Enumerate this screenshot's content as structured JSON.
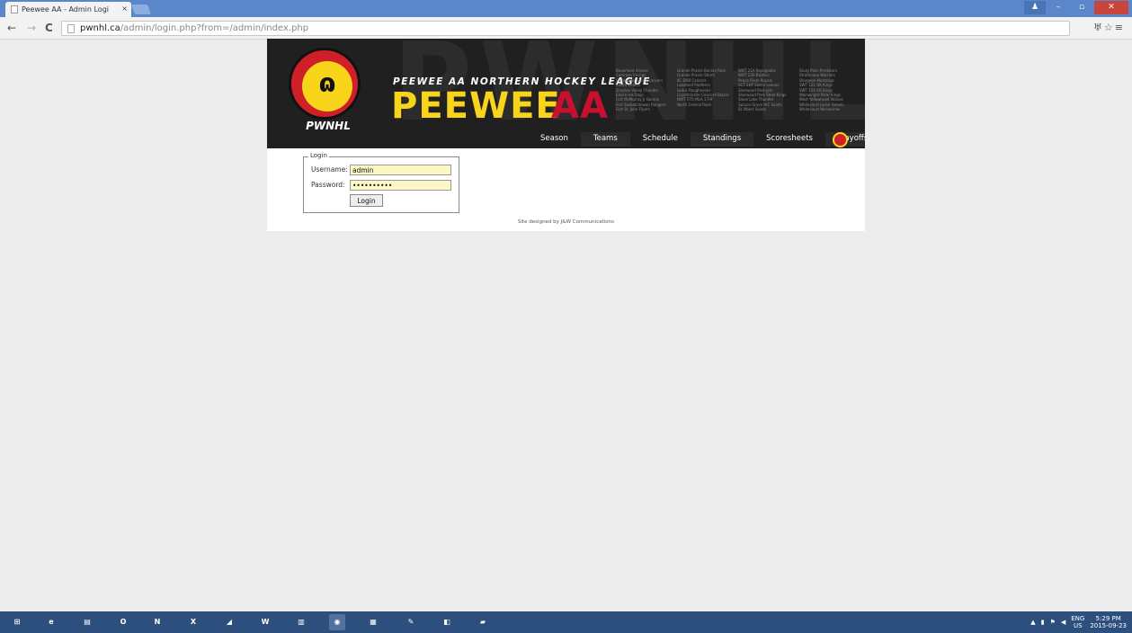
{
  "browser": {
    "tab_title": "Peewee AA - Admin Logi",
    "tab_close": "×",
    "back": "←",
    "forward": "→",
    "reload": "C",
    "url_host": "pwnhl.ca",
    "url_path": "/admin/login.php?from=/admin/index.php",
    "toolbar_icons": "♅☆≡",
    "window_controls": {
      "user": "♟",
      "minimize": "–",
      "maximize": "▫",
      "close": "✕"
    }
  },
  "banner": {
    "logo_text": "PWNHL",
    "logo_glyph": "ɷ",
    "tagline": "PEEWEE AA NORTHERN HOCKEY LEAGUE",
    "title_main": "PEEWEE",
    "title_sub": "AA",
    "ghost_text": "PWNHL",
    "team_columns": [
      [
        "Beaumont Braves",
        "Camrose Vikings",
        "Clearwater Storm Lancers",
        "Edson Zeltics",
        "Drayton Valley Thunder",
        "Edson Ice Dogs",
        "Fort McMurray Jr Barons",
        "Fort Saskatchewan Rangers",
        "Fort St. John Flyers"
      ],
      [
        "Grande Prairie Bonnie Ross",
        "Grande Prairie Storm",
        "KC DRB Cancers",
        "Lakeland Panthers",
        "Leduc Roughnecks",
        "Lloydminster Concord Blazers",
        "NWT 5TO MLA 17HF",
        "North Central Rush"
      ],
      [
        "NWT 21A Renegades",
        "NWT 23A Raiders",
        "Peace River Royals",
        "SCT SHT Sierra Leones",
        "Sherwood Park Jets",
        "Sherwood Park Steel Kings",
        "Slave Lake Thunder",
        "Spruce Grove HIC Saints",
        "St Albert Saints"
      ],
      [
        "Sturg Plain Predators",
        "Strathcona Warriors",
        "Sturgeon Mustangs",
        "SWT 121 OK Kings",
        "SWT 124 OK Kings",
        "Wainwright Polar Kings",
        "West Yellowhead Wolves",
        "Whitecourt Junior Rebels",
        "Whitecourt Wolverines"
      ]
    ],
    "nav": [
      "Season",
      "Teams",
      "Schedule",
      "Standings",
      "Scoresheets",
      "Playoffs"
    ]
  },
  "login": {
    "legend": "Login",
    "username_label": "Username:",
    "username_value": "admin",
    "password_label": "Password:",
    "password_value": "••••••••••",
    "button": "Login"
  },
  "footer": "Site designed by J&W Communications",
  "taskbar": {
    "apps": [
      {
        "name": "start",
        "glyph": "⊞"
      },
      {
        "name": "internet-explorer",
        "glyph": "e"
      },
      {
        "name": "file-explorer",
        "glyph": "▤"
      },
      {
        "name": "outlook",
        "glyph": "O"
      },
      {
        "name": "onenote",
        "glyph": "N"
      },
      {
        "name": "excel",
        "glyph": "X"
      },
      {
        "name": "app",
        "glyph": "◢"
      },
      {
        "name": "word",
        "glyph": "W"
      },
      {
        "name": "notepad",
        "glyph": "▥"
      },
      {
        "name": "chrome",
        "glyph": "◉"
      },
      {
        "name": "app2",
        "glyph": "▦"
      },
      {
        "name": "paint",
        "glyph": "✎"
      },
      {
        "name": "app3",
        "glyph": "◧"
      },
      {
        "name": "app4",
        "glyph": "▰"
      }
    ],
    "tray_lang": "ENG",
    "tray_region": "US",
    "tray_time": "5:29 PM",
    "tray_date": "2015-09-23"
  }
}
